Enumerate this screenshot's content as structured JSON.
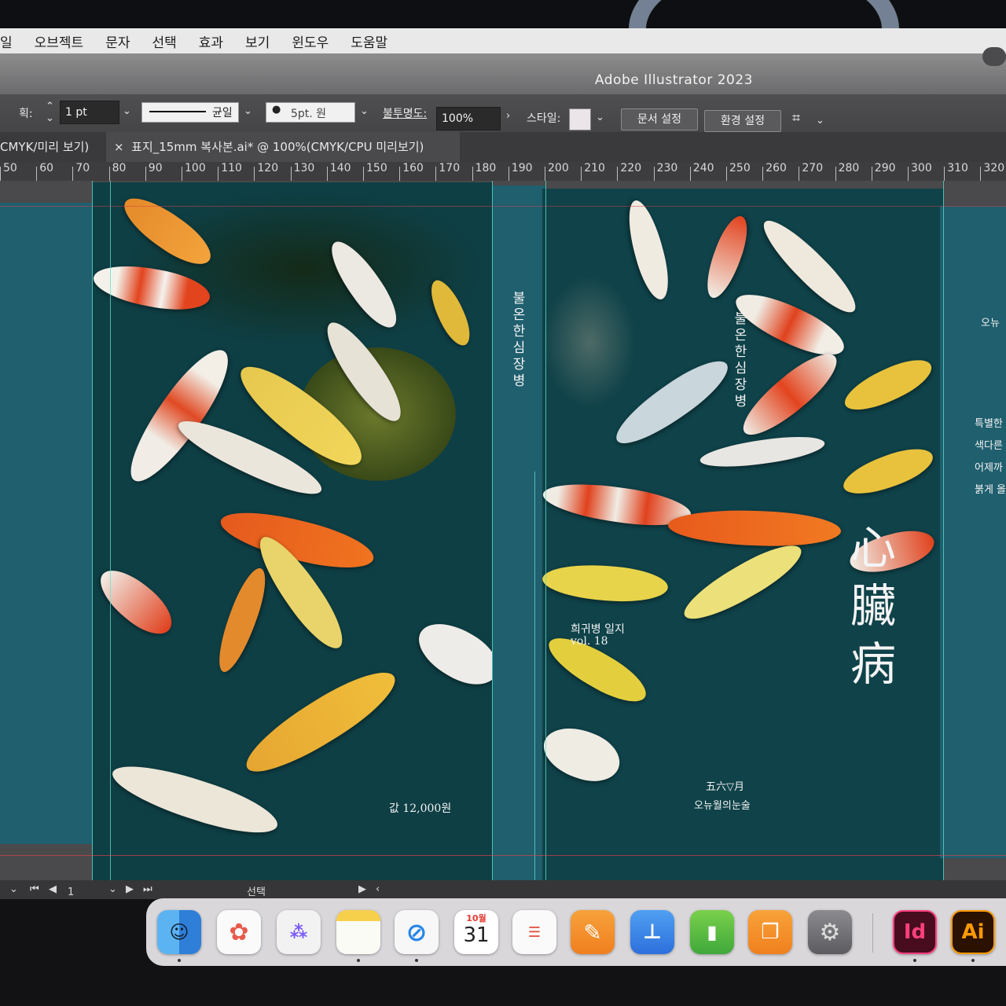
{
  "menubar": {
    "items": [
      "일",
      "오브젝트",
      "문자",
      "선택",
      "효과",
      "보기",
      "윈도우",
      "도움말"
    ]
  },
  "window": {
    "app_title": "Adobe Illustrator 2023"
  },
  "controlbar": {
    "stroke_label": "획:",
    "stroke_weight": "1 pt",
    "stroke_profile": "균일",
    "brush": "5pt. 원",
    "opacity_label": "불투명도:",
    "opacity_value": "100%",
    "style_label": "스타일:",
    "doc_setup_button": "문서 설정",
    "prefs_button": "환경 설정"
  },
  "tabs": [
    {
      "label": "CMYK/미리 보기)"
    },
    {
      "label": "표지_15mm 복사본.ai* @ 100%(CMYK/CPU 미리보기)",
      "close": "×"
    }
  ],
  "ruler": {
    "ticks": [
      "50",
      "60",
      "70",
      "80",
      "90",
      "100",
      "110",
      "120",
      "130",
      "140",
      "150",
      "160",
      "170",
      "180",
      "190",
      "200",
      "210",
      "220",
      "230",
      "240",
      "250",
      "260",
      "270",
      "280",
      "290",
      "300",
      "310",
      "320"
    ]
  },
  "cover": {
    "spine_title": "불온한심장병",
    "front_title_vertical": "불온한심장병",
    "series": "희귀병 일지",
    "volume": "vol. 18",
    "price": "값 12,000원",
    "hanja_title": [
      "心",
      "臟",
      "病"
    ],
    "publisher_date": "五六▽月",
    "publisher": "오뉴월의눈술",
    "flap_heading": "오뉴",
    "flap_lines": [
      "특별한",
      "색다른",
      "어제까",
      "붉게 올"
    ]
  },
  "statusbar": {
    "page": "1",
    "tool": "선택"
  },
  "dock": {
    "calendar_month": "10월",
    "calendar_day": "31",
    "indesign_label": "Id",
    "illustrator_label": "Ai",
    "apps": [
      "finder-icon",
      "photos-icon",
      "launchpad-icon",
      "notes-icon",
      "safari-icon",
      "calendar-icon",
      "reminders-icon",
      "pages-icon",
      "keynote-icon",
      "numbers-icon",
      "books-icon",
      "system-settings-icon",
      "indesign-icon",
      "illustrator-icon"
    ]
  },
  "colors": {
    "cover_teal": "#1f5f6e",
    "pond_dark": "#0e3f45",
    "guide_cyan": "#5fe0d0"
  }
}
